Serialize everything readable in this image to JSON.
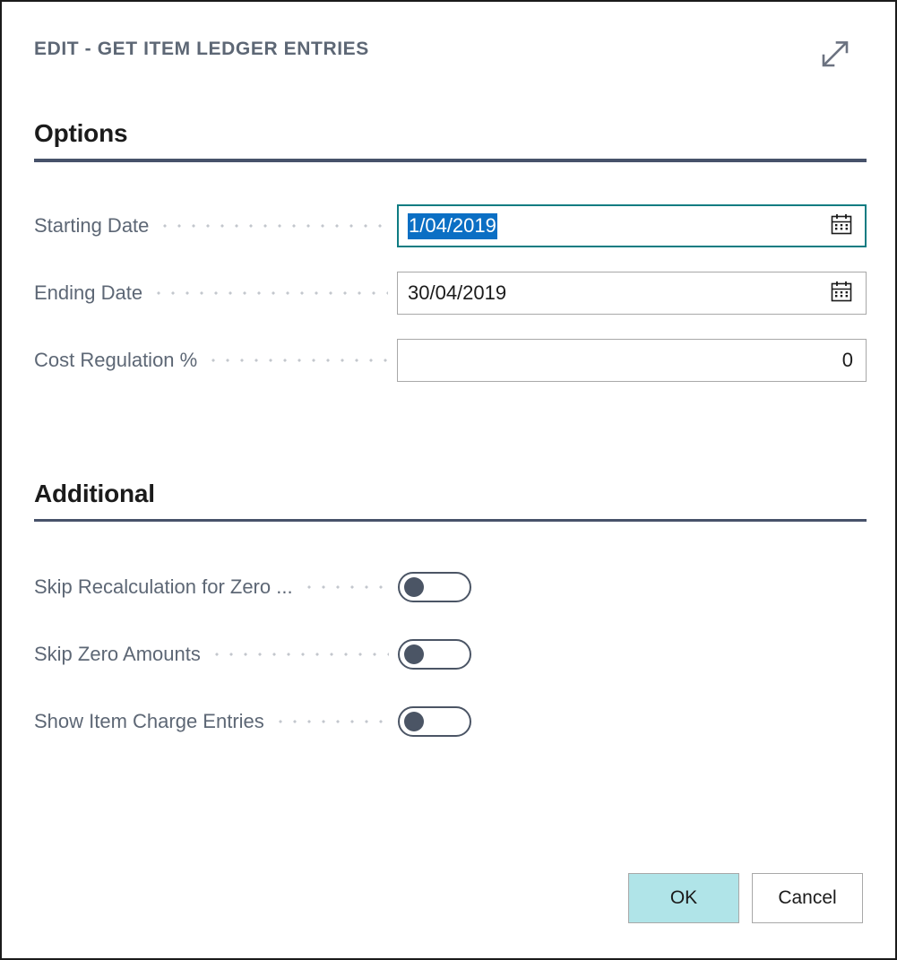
{
  "window": {
    "title": "EDIT - GET ITEM LEDGER ENTRIES",
    "expand_icon": "expand-diagonal-icon"
  },
  "sections": [
    {
      "heading": "Options"
    },
    {
      "heading": "Additional"
    }
  ],
  "options": {
    "heading": "Options",
    "fields": [
      {
        "label": "Starting Date",
        "value": "1/04/2019",
        "type": "date",
        "icon": "calendar-icon",
        "focused": true,
        "selected": true
      },
      {
        "label": "Ending Date",
        "value": "30/04/2019",
        "type": "date",
        "icon": "calendar-icon",
        "focused": false,
        "selected": false
      },
      {
        "label": "Cost Regulation %",
        "value": "0",
        "type": "number",
        "icon": null,
        "focused": false,
        "selected": false
      }
    ]
  },
  "additional": {
    "heading": "Additional",
    "toggles": [
      {
        "label": "Skip Recalculation for Zero ...",
        "on": false
      },
      {
        "label": "Skip Zero Amounts",
        "on": false
      },
      {
        "label": "Show Item Charge Entries",
        "on": false
      }
    ]
  },
  "footer": {
    "ok_label": "OK",
    "cancel_label": "Cancel"
  },
  "colors": {
    "title_text": "#5d6775",
    "label_text": "#5d6775",
    "section_rule": "#47526a",
    "focus_border": "#0e7c82",
    "selection_bg": "#0b6fc4",
    "primary_button_bg": "#b0e4e8",
    "field_border": "#a8a8a8",
    "toggle_color": "#4b5565"
  }
}
